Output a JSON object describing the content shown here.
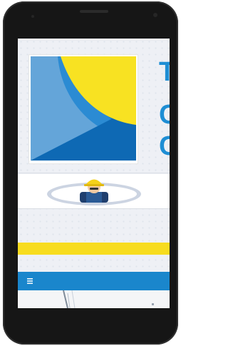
{
  "colors": {
    "device": "#161616",
    "accent_blue": "#1e8ed4",
    "accent_yellow": "#f7dc1e",
    "nav_blue": "#1a86cc"
  },
  "hero": {
    "title_letters": [
      "T",
      "C",
      "C"
    ]
  },
  "nav": {
    "menu_icon": "hamburger-icon"
  }
}
